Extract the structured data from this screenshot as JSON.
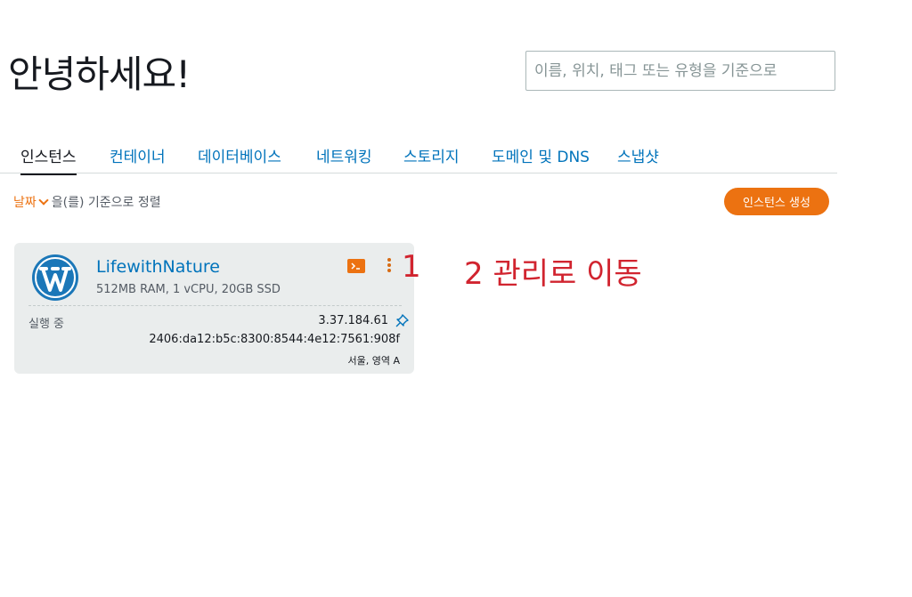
{
  "header": {
    "greeting": "안녕하세요!",
    "search_placeholder": "이름, 위치, 태그 또는 유형을 기준으로"
  },
  "tabs": [
    {
      "label": "인스턴스",
      "active": true
    },
    {
      "label": "컨테이너",
      "active": false
    },
    {
      "label": "데이터베이스",
      "active": false
    },
    {
      "label": "네트워킹",
      "active": false
    },
    {
      "label": "스토리지",
      "active": false
    },
    {
      "label": "도메인 및 DNS",
      "active": false
    },
    {
      "label": "스냅샷",
      "active": false
    }
  ],
  "sort": {
    "field": "날짜",
    "suffix": "을(를) 기준으로 정렬"
  },
  "create_button": "인스턴스 생성",
  "instance": {
    "name": "LifewithNature",
    "spec": "512MB RAM, 1 vCPU, 20GB SSD",
    "status": "실행 중",
    "ipv4": "3.37.184.61",
    "ipv6": "2406:da12:b5c:8300:8544:4e12:7561:908f",
    "region": "서울, 영역 A",
    "logo_icon": "wordpress-icon",
    "connect_icon": "terminal-icon",
    "menu_icon": "kebab-menu-icon",
    "pin_icon": "pin-icon"
  },
  "annotations": {
    "step1": "1",
    "step2": "2 관리로 이동"
  },
  "colors": {
    "accent": "#ec7211",
    "link": "#0073bb",
    "card_bg": "#eaeded",
    "annotation": "#d1242f"
  }
}
